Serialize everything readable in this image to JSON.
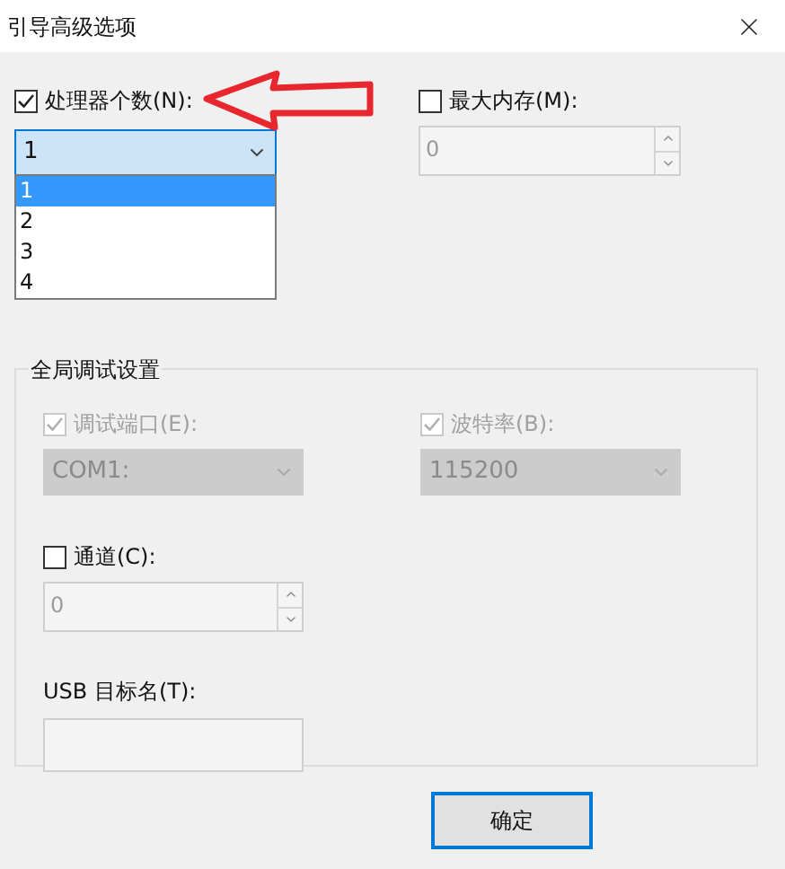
{
  "window": {
    "title": "引导高级选项"
  },
  "processors": {
    "label": "处理器个数(N):",
    "checked": true,
    "value": "1",
    "options": [
      {
        "label": "1",
        "selected": true
      },
      {
        "label": "2",
        "selected": false
      },
      {
        "label": "3",
        "selected": false
      },
      {
        "label": "4",
        "selected": false
      }
    ]
  },
  "max_memory": {
    "label": "最大内存(M):",
    "checked": false,
    "value": "0"
  },
  "debug": {
    "title": "全局调试设置",
    "port": {
      "label": "调试端口(E):",
      "checked": true,
      "disabled": true,
      "value": "COM1:"
    },
    "baud": {
      "label": "波特率(B):",
      "checked": true,
      "disabled": true,
      "value": "115200"
    },
    "channel": {
      "label": "通道(C):",
      "checked": false,
      "value": "0"
    },
    "usb": {
      "label": "USB 目标名(T):"
    }
  },
  "buttons": [
    {
      "label": "确定"
    }
  ]
}
